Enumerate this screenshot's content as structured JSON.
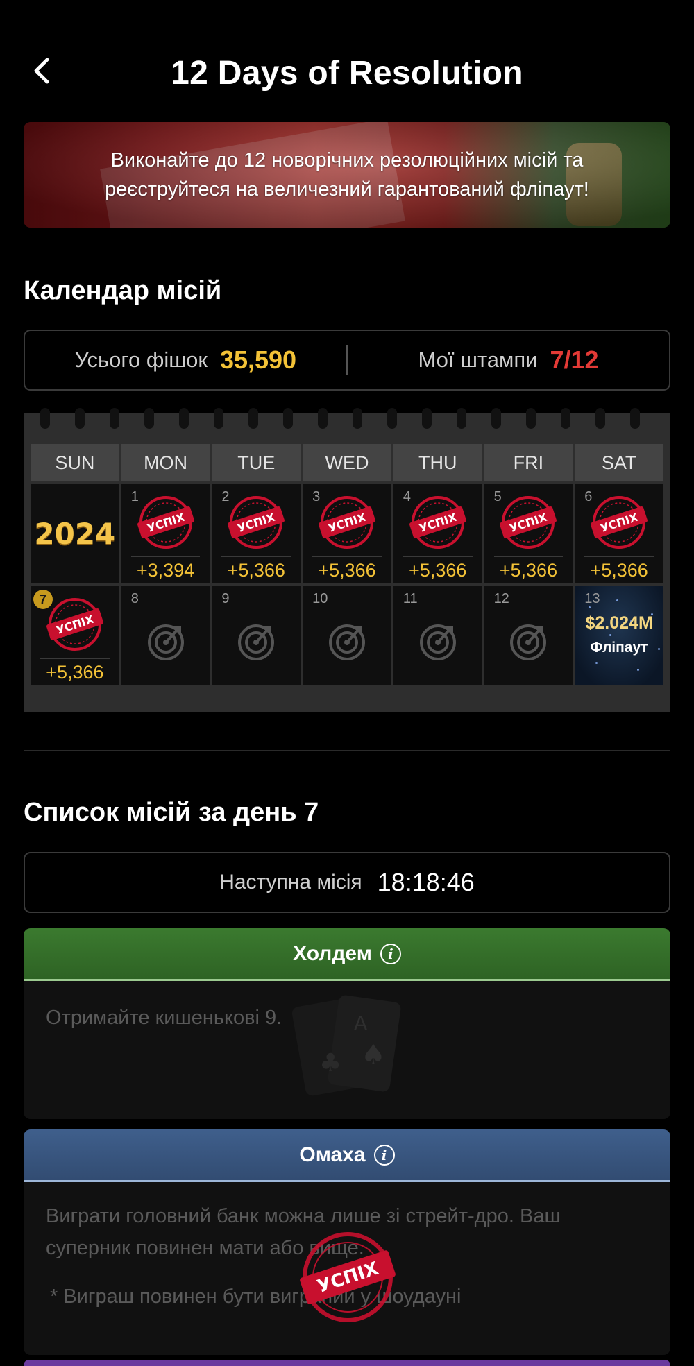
{
  "header": {
    "title": "12 Days of Resolution",
    "back_icon": "chevron-left-icon"
  },
  "banner": {
    "text": "Виконайте до 12 новорічних резолюційних місій та реєструйтеся на величезний гарантований фліпаут!"
  },
  "calendar_section": {
    "title": "Календар місій",
    "stats": {
      "chips_label": "Усього фішок",
      "chips_value": "35,590",
      "stamps_label": "Мої штампи",
      "stamps_value": "7/12"
    },
    "weekdays": [
      "SUN",
      "MON",
      "TUE",
      "WED",
      "THU",
      "FRI",
      "SAT"
    ],
    "year_label": "2024",
    "stamp_text": "УСПІХ",
    "days": [
      {
        "num": "1",
        "reward": "+3,394"
      },
      {
        "num": "2",
        "reward": "+5,366"
      },
      {
        "num": "3",
        "reward": "+5,366"
      },
      {
        "num": "4",
        "reward": "+5,366"
      },
      {
        "num": "5",
        "reward": "+5,366"
      },
      {
        "num": "6",
        "reward": "+5,366"
      },
      {
        "num": "7",
        "reward": "+5,366"
      },
      {
        "num": "8"
      },
      {
        "num": "9"
      },
      {
        "num": "10"
      },
      {
        "num": "11"
      },
      {
        "num": "12"
      },
      {
        "num": "13",
        "amount": "$2.024M",
        "label": "Фліпаут"
      }
    ]
  },
  "missions_section": {
    "title": "Список місій за день 7",
    "timer_label": "Наступна місія",
    "timer_value": "18:18:46",
    "missions": [
      {
        "name": "Холдем",
        "color": "#3b7a2f",
        "description": "Отримайте кишенькові 9."
      },
      {
        "name": "Омаха",
        "color": "#3f5f8c",
        "description": "Виграти головний банк можна лише зі стрейт-дро. Ваш суперник повинен мати",
        "description_tail": "або вище.",
        "note": "* Виграш повинен бути виграний у шоудауні",
        "stamp": "УСПІХ"
      }
    ]
  },
  "colors": {
    "gold": "#f3c237",
    "red": "#e33a36",
    "stamp_red": "#c8102e"
  }
}
